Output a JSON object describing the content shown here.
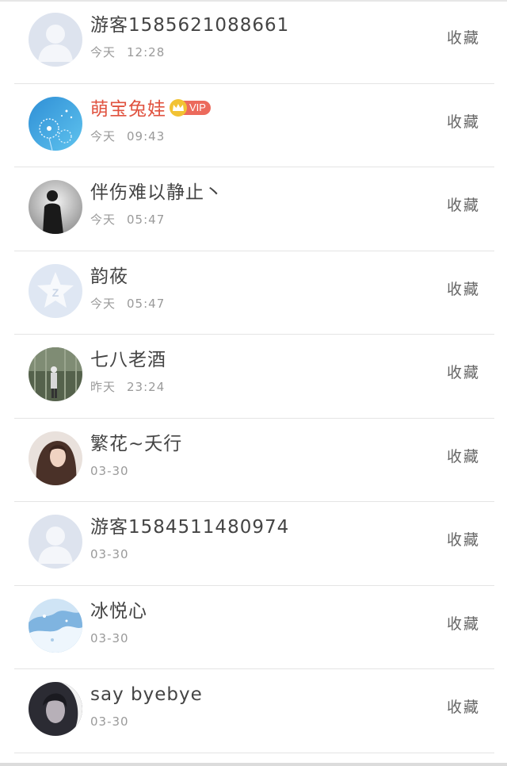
{
  "favorite_label": "收藏",
  "rows": [
    {
      "name": "游客1585621088661",
      "day": "今天",
      "time": "12:28",
      "vip": false,
      "avatar": "default-avatar"
    },
    {
      "name": "萌宝兔娃",
      "day": "今天",
      "time": "09:43",
      "vip": true,
      "vip_label": "VIP",
      "avatar": "dandelion-avatar"
    },
    {
      "name": "伴伤难以静止丶",
      "day": "今天",
      "time": "05:47",
      "vip": false,
      "avatar": "bw-person-avatar"
    },
    {
      "name": "韵莜",
      "day": "今天",
      "time": "05:47",
      "vip": false,
      "avatar": "qq-star-avatar"
    },
    {
      "name": "七八老酒",
      "day": "昨天",
      "time": "23:24",
      "vip": false,
      "avatar": "greenhouse-avatar"
    },
    {
      "name": "繁花~夭行",
      "day": "",
      "time": "03-30",
      "vip": false,
      "avatar": "girl-hair-avatar"
    },
    {
      "name": "游客1584511480974",
      "day": "",
      "time": "03-30",
      "vip": false,
      "avatar": "default-avatar"
    },
    {
      "name": "冰悦心",
      "day": "",
      "time": "03-30",
      "vip": false,
      "avatar": "winter-avatar"
    },
    {
      "name": "say  byebye",
      "day": "",
      "time": "03-30",
      "vip": false,
      "avatar": "dark-portrait-avatar"
    }
  ],
  "colors": {
    "vip_name": "#e0523f",
    "vip_badge": "#ec6a5c",
    "crown": "#f2c233",
    "time_text": "#9a9a9a",
    "divider": "#e4e4e4"
  }
}
